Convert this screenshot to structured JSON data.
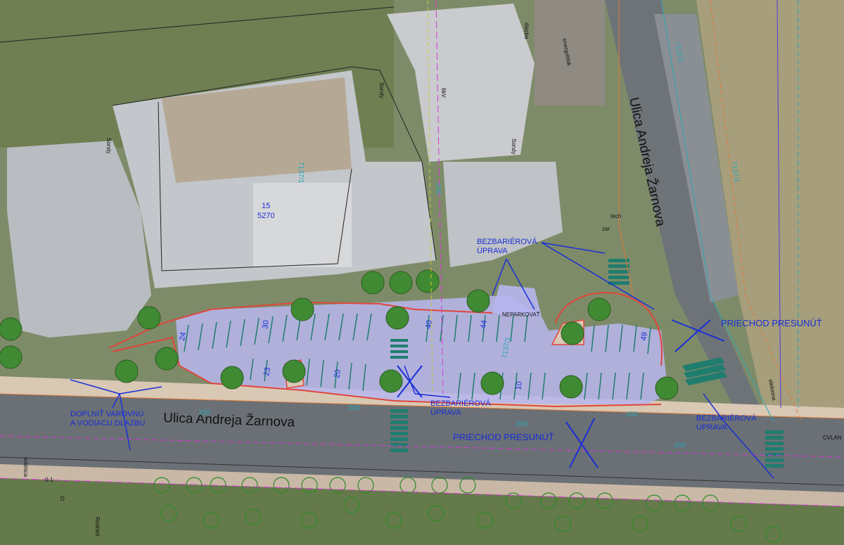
{
  "streets": {
    "horizontal": "Ulica  Andreja Žarnova",
    "vertical": "Ulica  Andreja Žarnova"
  },
  "annotations": {
    "bezbarierova_top": [
      "BEZBARIÉROVÁ",
      "ÚPRAVA"
    ],
    "bezbarierova_mid": [
      "BEZBARIÉROVÁ",
      "ÚPRAVA"
    ],
    "bezbarierova_right": [
      "BEZBARIÉROVÁ",
      "ÚPRAVA"
    ],
    "priechod_right": "PRIECHOD PRESUNÚŤ",
    "priechod_bottom": "PRIECHOD PRESUNÚŤ",
    "doplnit": [
      "DOPLNIŤ VAROVNÚ",
      "A VODIACU DLAZBU"
    ]
  },
  "parking_numbers": [
    "24",
    "30",
    "23",
    "20",
    "40",
    "44",
    "10",
    "49"
  ],
  "small_labels": {
    "kotelna_top": "dlazba",
    "energoblok": "energoblok",
    "sonday1": "Sondy",
    "sonday2": "Sondy",
    "sonday3": "Sondy",
    "bud_num": "15",
    "bud_num2": "5270",
    "tech": "tech",
    "zar": "zar",
    "vratnica": "vrátnica",
    "ozn": "0-1",
    "rodries": "Rodrieš",
    "d": "D",
    "neparkovat": "NEPARKOVAŤ",
    "elektrina": "elektrina",
    "kvlan": "CVLAN"
  },
  "dimensions": {
    "d200a": "200",
    "d200b": "200",
    "d200c": "200",
    "d150a": "150",
    "d150b": "150",
    "d150c": "150",
    "d713a": "7137/1",
    "d713b": "7137/1",
    "d713c": "7137/1",
    "d713d": "7137/1",
    "d6kv": "6kV"
  },
  "colors": {
    "parking_fill": "#b8b6f0",
    "annotation_blue": "#1a2fd6",
    "crosswalk": "#1f7d6e",
    "curb_red": "#e0463a",
    "road": "#6f7579",
    "building": "#c7c9cc",
    "sidewalk": "#d9c9b9",
    "vegetation": "#5f7a3c"
  }
}
